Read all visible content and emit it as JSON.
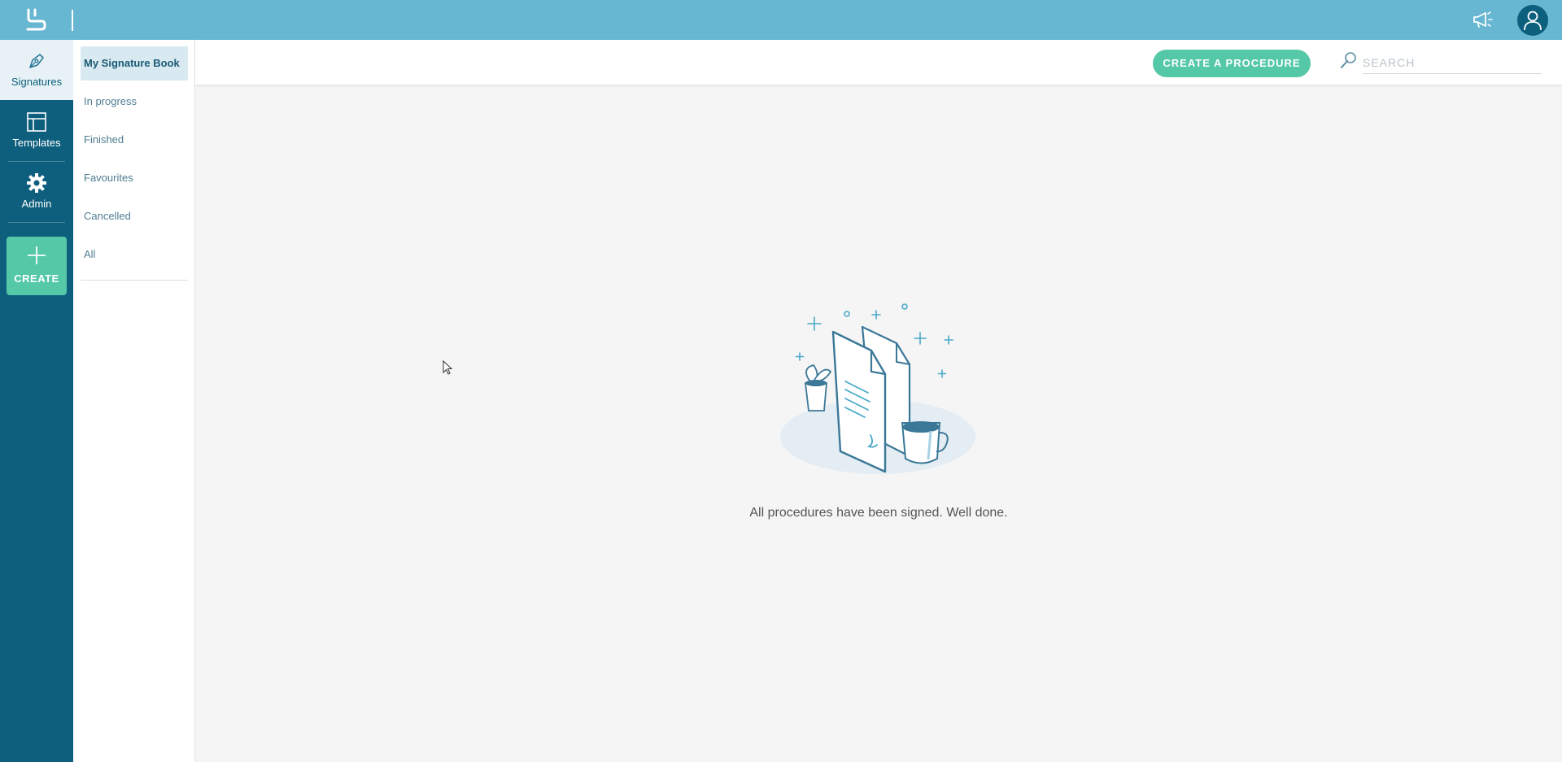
{
  "topbar": {
    "logo_icon": "brand-logo-icon",
    "announce_icon": "megaphone-icon",
    "avatar_icon": "user-icon",
    "color": "#67b6d2"
  },
  "rail": {
    "items": [
      {
        "label": "Signatures",
        "icon": "pen-nib-icon",
        "active": true
      },
      {
        "label": "Templates",
        "icon": "layout-icon",
        "active": false
      },
      {
        "label": "Admin",
        "icon": "gear-icon",
        "active": false
      }
    ],
    "create_label": "CREATE",
    "color": "#0e5f7d",
    "accent": "#55c8a8"
  },
  "subnav": {
    "items": [
      {
        "label": "My Signature Book",
        "active": true
      },
      {
        "label": "In progress",
        "active": false
      },
      {
        "label": "Finished",
        "active": false
      },
      {
        "label": "Favourites",
        "active": false
      },
      {
        "label": "Cancelled",
        "active": false
      },
      {
        "label": "All",
        "active": false
      }
    ]
  },
  "header": {
    "cta_label": "CREATE A PROCEDURE",
    "search_placeholder": "SEARCH",
    "search_value": ""
  },
  "main": {
    "empty_message": "All procedures have been signed. Well done.",
    "illustration_icon": "documents-with-coffee-illustration"
  }
}
